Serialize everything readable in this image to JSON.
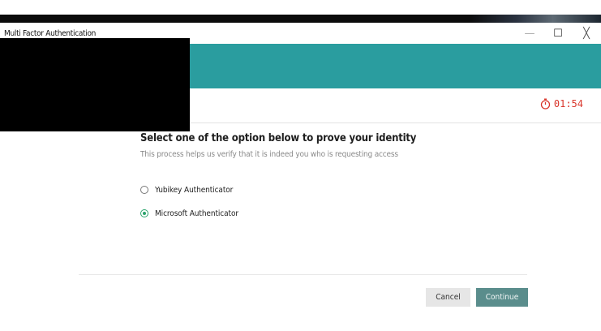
{
  "window": {
    "title": "Multi Factor Authentication",
    "controls": {
      "minimize": "—",
      "maximize": "☐",
      "close": "╳"
    }
  },
  "timer": {
    "value": "01:54",
    "color": "#d9362b",
    "icon": "stopwatch-icon"
  },
  "colors": {
    "header": "#2a9d9f",
    "selected_radio": "#2aa36b",
    "continue_button": "#5a8d8c"
  },
  "main": {
    "heading": "Select one of the option below to prove your identity",
    "subtext": "This process helps us verify that it is indeed you who is requesting access",
    "options": [
      {
        "label": "Yubikey Authenticator",
        "selected": false
      },
      {
        "label": "Microsoft Authenticator",
        "selected": true
      }
    ]
  },
  "buttons": {
    "cancel": "Cancel",
    "continue": "Continue"
  }
}
